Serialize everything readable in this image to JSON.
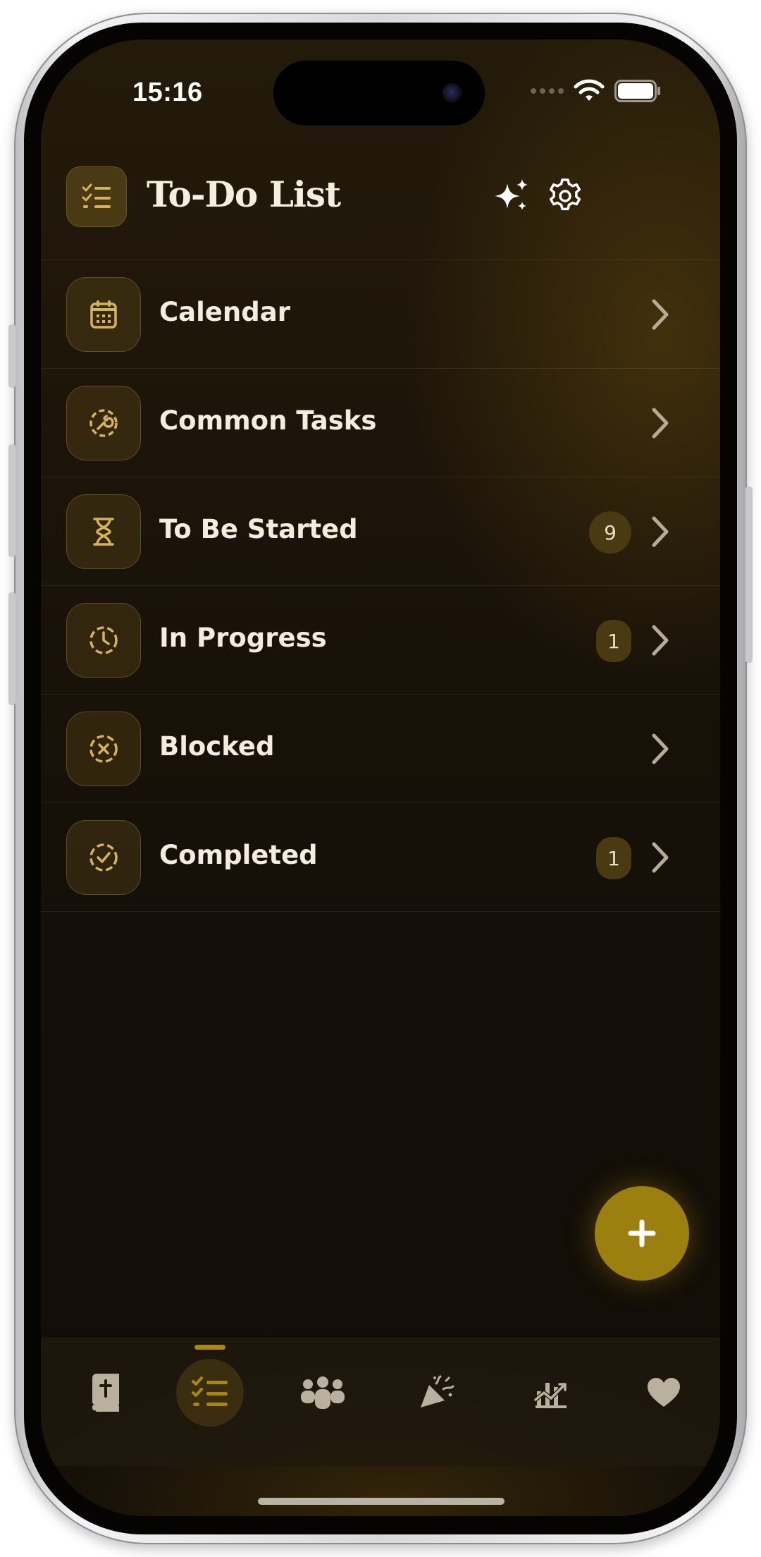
{
  "status_bar": {
    "time": "15:16"
  },
  "header": {
    "title": "To-Do List",
    "icons": {
      "badge": "checklist-icon",
      "magic": "sparkles-icon",
      "settings": "gear-icon"
    }
  },
  "lists": [
    {
      "label": "Calendar",
      "icon": "calendar-icon",
      "count": null
    },
    {
      "label": "Common Tasks",
      "icon": "wrench-icon",
      "count": null
    },
    {
      "label": "To Be Started",
      "icon": "hourglass-icon",
      "count": "9"
    },
    {
      "label": "In Progress",
      "icon": "clock-icon",
      "count": "1"
    },
    {
      "label": "Blocked",
      "icon": "x-circle-icon",
      "count": null
    },
    {
      "label": "Completed",
      "icon": "check-circle-icon",
      "count": "1"
    }
  ],
  "fab": {
    "icon": "plus-icon"
  },
  "tab_bar": {
    "tabs": [
      {
        "icon": "book-icon"
      },
      {
        "icon": "checklist-icon",
        "active": true
      },
      {
        "icon": "people-icon"
      },
      {
        "icon": "party-popper-icon"
      },
      {
        "icon": "chart-icon"
      },
      {
        "icon": "heart-icon"
      }
    ]
  },
  "colors": {
    "accent": "#9c800f",
    "background": "#140f08",
    "text": "#f4ecdc",
    "badge_bg": "#4a3a12"
  }
}
